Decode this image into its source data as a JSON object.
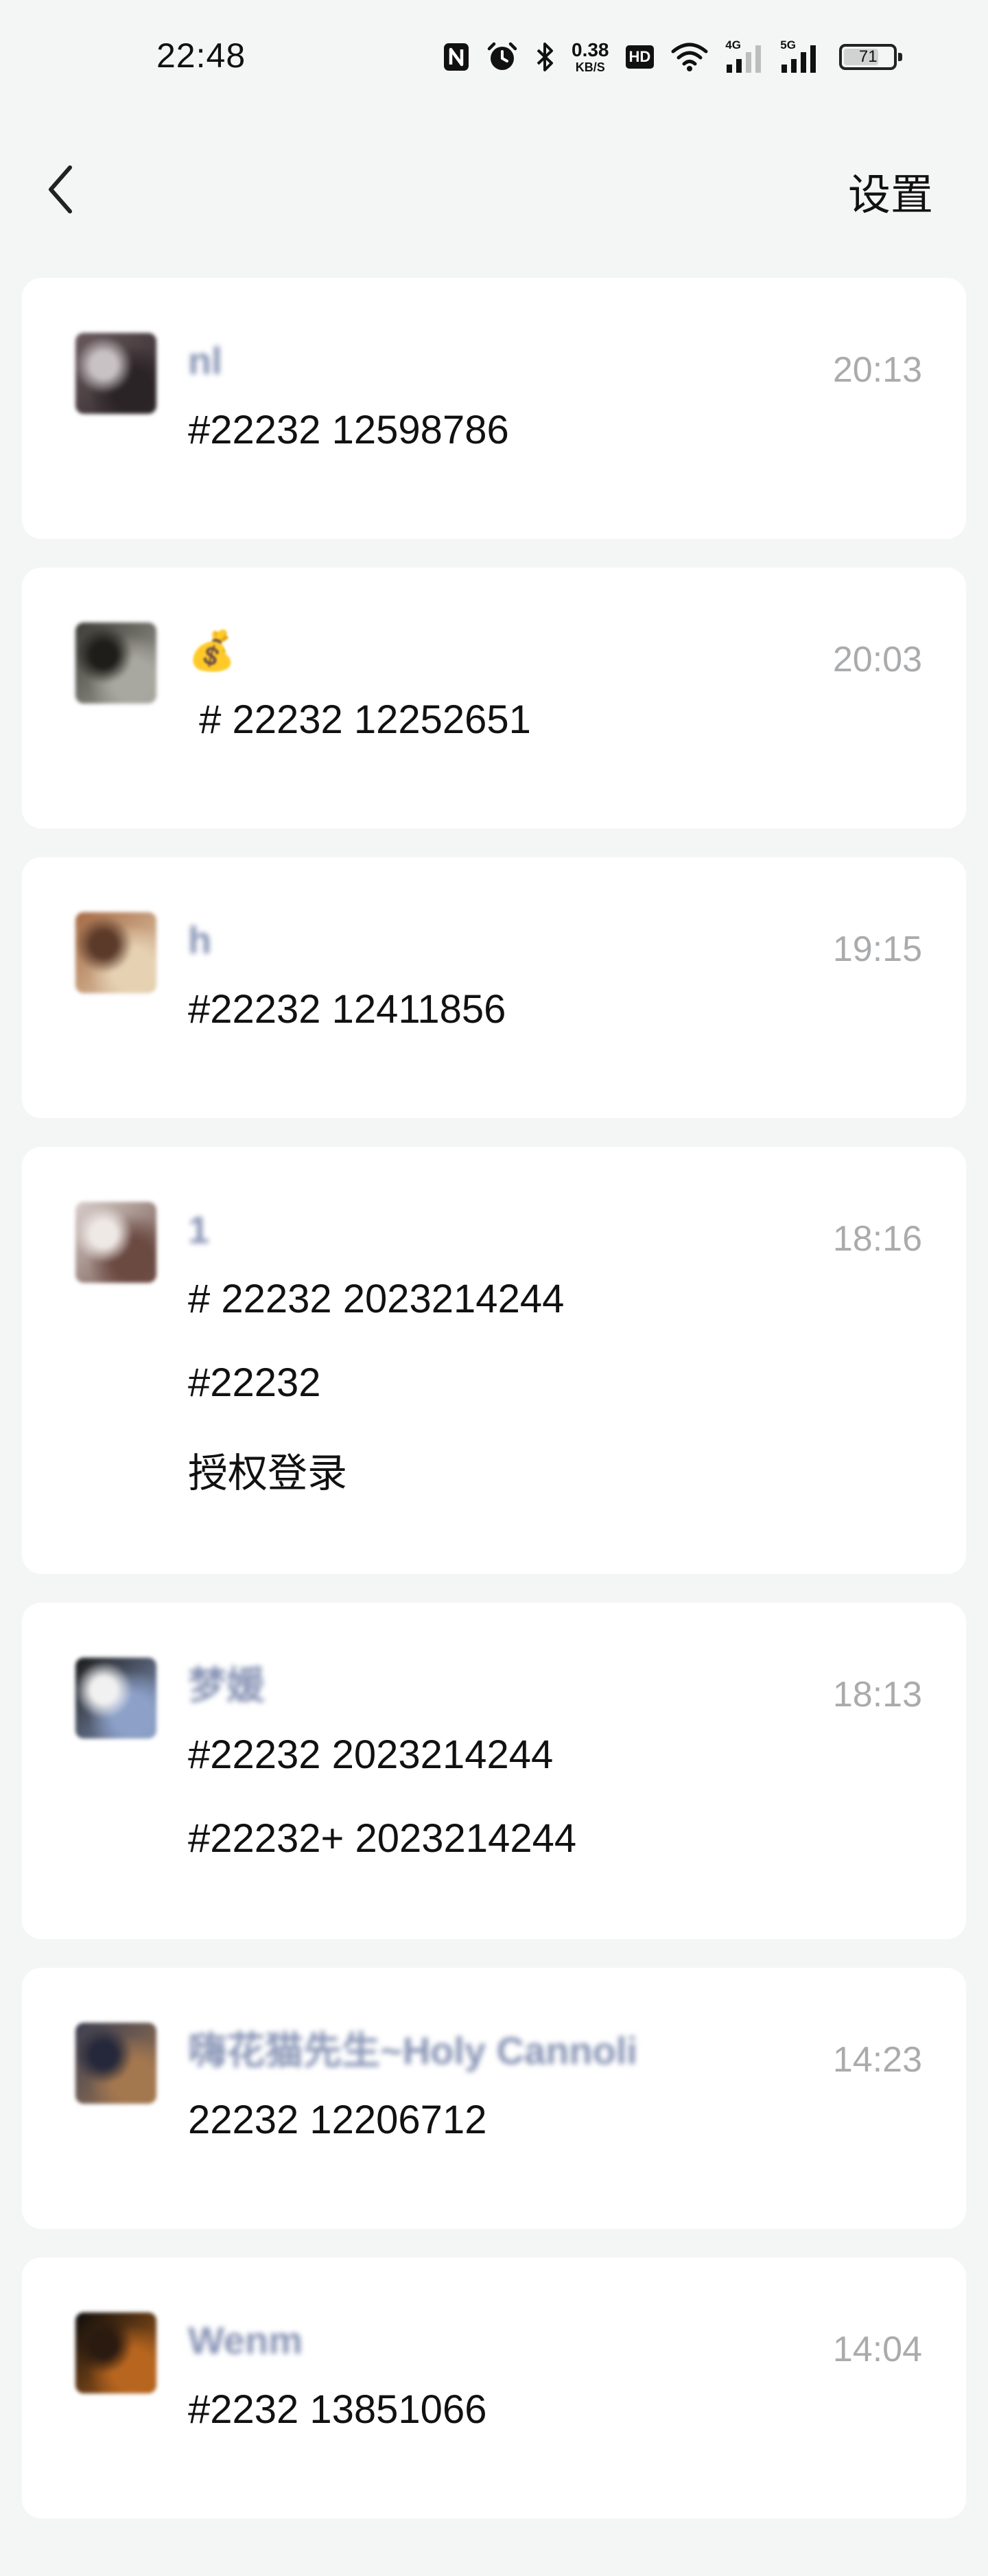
{
  "status_bar": {
    "time": "22:48",
    "net_speed_value": "0.38",
    "net_speed_unit": "KB/S",
    "hd_label": "HD",
    "signal_1_label": "4G",
    "signal_2_label": "5G",
    "battery_level": "71",
    "icons": [
      "nfc-icon",
      "alarm-icon",
      "bluetooth-icon",
      "wifi-icon",
      "signal-icon",
      "battery-icon"
    ]
  },
  "nav": {
    "back_icon": "chevron-left-icon",
    "settings_label": "设置"
  },
  "messages": [
    {
      "sender": "nl",
      "time": "20:13",
      "lines": [
        "#22232 12598786"
      ],
      "avatar_colors": [
        "#6a5a5e",
        "#2b2426",
        "#c9c2c5"
      ]
    },
    {
      "sender": "💰",
      "time": "20:03",
      "lines": [
        " # 22232 12252651"
      ],
      "avatar_colors": [
        "#3c3b35",
        "#a9a8a0",
        "#1e1d19"
      ]
    },
    {
      "sender": "h",
      "time": "19:15",
      "lines": [
        "#22232 12411856"
      ],
      "avatar_colors": [
        "#a56a45",
        "#e6d2b3",
        "#5b3a29"
      ]
    },
    {
      "sender": "1",
      "time": "18:16",
      "lines": [
        "# 22232 2023214244",
        "#22232",
        "授权登录"
      ],
      "avatar_colors": [
        "#d8cfcc",
        "#6b4a42",
        "#efe9e6"
      ]
    },
    {
      "sender": "梦媛",
      "time": "18:13",
      "lines": [
        "#22232 2023214244",
        "#22232+ 2023214244"
      ],
      "avatar_colors": [
        "#1a1a1a",
        "#8ca0c8",
        "#f1f1f1"
      ]
    },
    {
      "sender": "嗨花猫先生~Holy Cannoli",
      "time": "14:23",
      "lines": [
        "22232 12206712"
      ],
      "avatar_colors": [
        "#3b3f52",
        "#a4784f",
        "#25283a"
      ]
    },
    {
      "sender": "Wenm",
      "time": "14:04",
      "lines": [
        "#2232 13851066"
      ],
      "avatar_colors": [
        "#0d0c0b",
        "#b8661f",
        "#2a1a10"
      ]
    }
  ]
}
